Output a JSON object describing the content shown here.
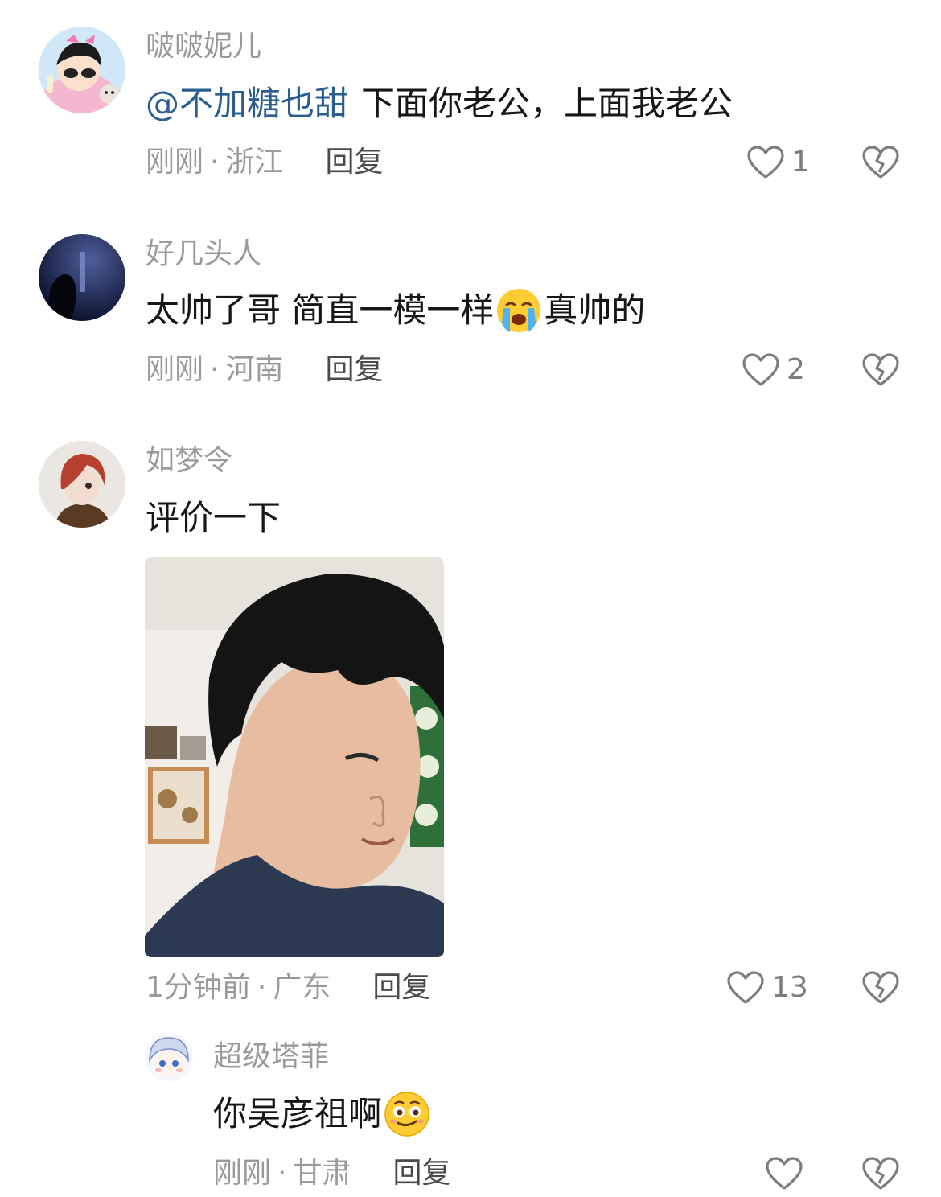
{
  "comments": [
    {
      "username": "啵啵妮儿",
      "mention": "@不加糖也甜",
      "text": "下面你老公，上面我老公",
      "time": "刚刚",
      "location": "浙江",
      "reply_label": "回复",
      "likes": "1",
      "avatar_icon": "cartoon-girl-avatar"
    },
    {
      "username": "好几头人",
      "text_before_emoji": "太帅了哥 简直一模一样",
      "emoji_icon": "loudly-crying-face-icon",
      "text_after_emoji": "真帅的",
      "time": "刚刚",
      "location": "河南",
      "reply_label": "回复",
      "likes": "2",
      "avatar_icon": "night-silhouette-avatar"
    },
    {
      "username": "如梦令",
      "text": "评价一下",
      "photo_icon": "selfie-photo",
      "time": "1分钟前",
      "location": "广东",
      "reply_label": "回复",
      "likes": "13",
      "avatar_icon": "anime-red-hair-avatar"
    }
  ],
  "reply": {
    "username": "超级塔菲",
    "text": "你吴彦祖啊",
    "emoji_icon": "smirk-face-icon",
    "time": "刚刚",
    "location": "甘肃",
    "reply_label": "回复",
    "avatar_icon": "anime-blue-hair-avatar"
  },
  "separator": "·",
  "colors": {
    "mention": "#2a5e91",
    "meta_text": "#9a9a9a",
    "body_text": "#161616"
  }
}
